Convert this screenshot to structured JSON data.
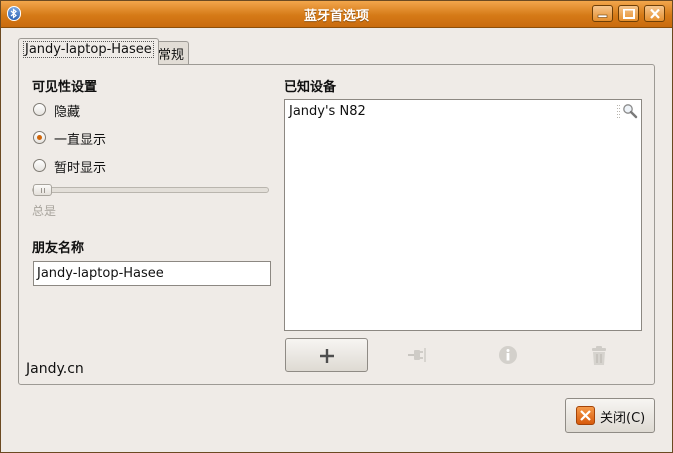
{
  "window": {
    "title": "蓝牙首选项",
    "controls": [
      "minimize",
      "maximize",
      "close"
    ]
  },
  "tabs": [
    {
      "label": "Jandy-laptop-Hasee",
      "active": true
    },
    {
      "label": "常规",
      "active": false
    }
  ],
  "visibility": {
    "heading": "可见性设置",
    "options": [
      {
        "label": "隐藏",
        "checked": false
      },
      {
        "label": "一直显示",
        "checked": true
      },
      {
        "label": "暂时显示",
        "checked": false
      }
    ],
    "timeout_caption": "总是",
    "timeout_level": 0
  },
  "friendly_name": {
    "heading": "朋友名称",
    "value": "Jandy-laptop-Hasee"
  },
  "known_devices": {
    "heading": "已知设备",
    "items": [
      "Jandy's N82"
    ]
  },
  "toolbar": {
    "add_icon": "plus-icon",
    "connect_icon": "plug-icon",
    "info_icon": "info-icon",
    "delete_icon": "trash-icon"
  },
  "footer": {
    "text": "Jandy.cn"
  },
  "close_button": {
    "label": "关闭(C)"
  },
  "colors": {
    "titlebar": "#d57a17",
    "accent": "#d0660a",
    "window_bg": "#efebe7"
  }
}
